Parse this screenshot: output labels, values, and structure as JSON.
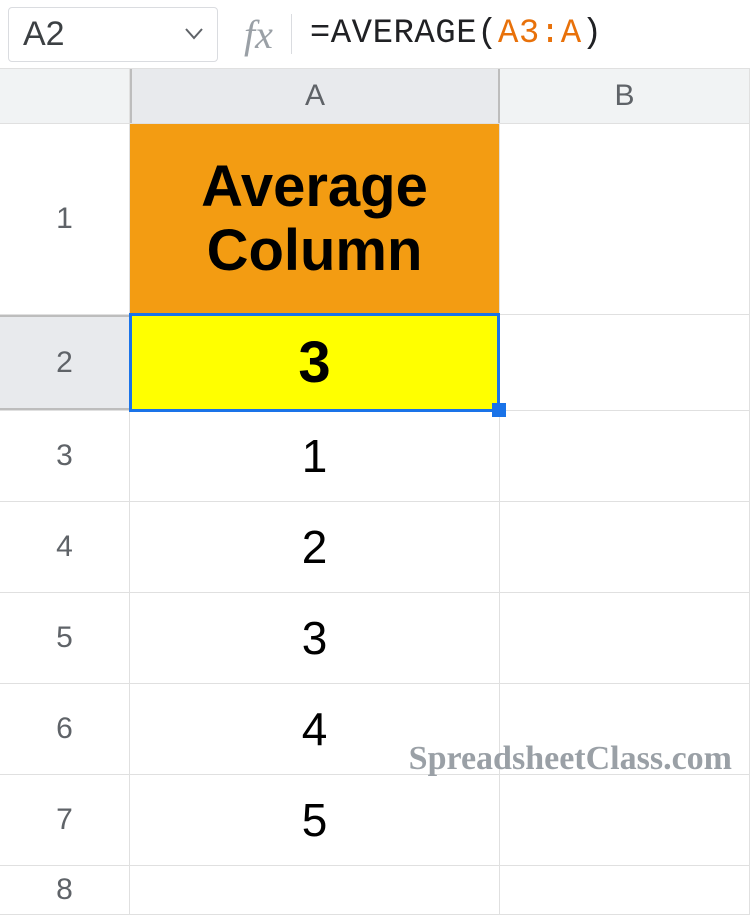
{
  "nameBox": {
    "value": "A2"
  },
  "formulaBar": {
    "fxLabel": "fx",
    "prefix": "=AVERAGE",
    "open": "(",
    "range": "A3:A",
    "close": ")"
  },
  "columnHeaders": {
    "a": "A",
    "b": "B"
  },
  "rowHeaders": {
    "r1": "1",
    "r2": "2",
    "r3": "3",
    "r4": "4",
    "r5": "5",
    "r6": "6",
    "r7": "7",
    "r8": "8"
  },
  "cells": {
    "a1": "Average Column",
    "a2": "3",
    "a3": "1",
    "a4": "2",
    "a5": "3",
    "a6": "4",
    "a7": "5"
  },
  "watermark": "SpreadsheetClass.com"
}
